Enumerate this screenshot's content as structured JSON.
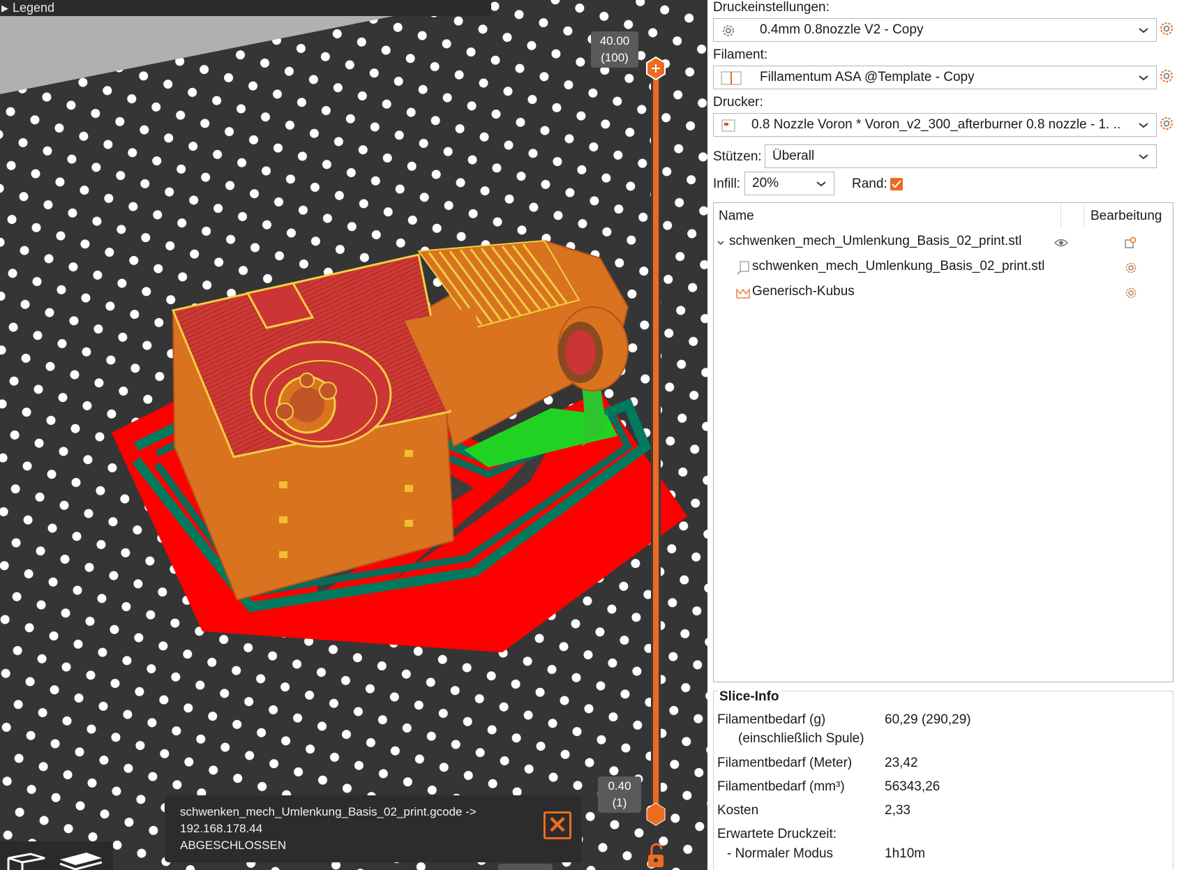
{
  "viewport": {
    "legend_label": "Legend",
    "layer_top": {
      "height": "40.00",
      "index": "(100)"
    },
    "layer_bottom": {
      "height": "0.40",
      "index": "(1)"
    },
    "notification": {
      "line1": "schwenken_mech_Umlenkung_Basis_02_print.gcode ->",
      "line2": "192.168.178.44",
      "line3": "ABGESCHLOSSEN"
    }
  },
  "panel": {
    "print_settings": {
      "label": "Druckeinstellungen:",
      "value": "0.4mm 0.8nozzle V2 - Copy"
    },
    "filament": {
      "label": "Filament:",
      "value": "Fillamentum ASA @Template - Copy"
    },
    "printer": {
      "label": "Drucker:",
      "value": "0.8 Nozzle Voron  * Voron_v2_300_afterburner 0.8 nozzle - 1. ..."
    },
    "supports": {
      "label": "Stützen:",
      "value": "Überall"
    },
    "infill": {
      "label": "Infill:",
      "value": "20%"
    },
    "brim": {
      "label": "Rand:",
      "checked": true
    },
    "object_list": {
      "col_name": "Name",
      "col_edit": "Bearbeitung",
      "rows": [
        {
          "label": "schwenken_mech_Umlenkung_Basis_02_print.stl",
          "icon": "chevron-down-icon"
        },
        {
          "label": "schwenken_mech_Umlenkung_Basis_02_print.stl",
          "icon": "part-icon"
        },
        {
          "label": "Generisch-Kubus",
          "icon": "support-blocker-icon"
        }
      ]
    },
    "slice_info": {
      "title": "Slice-Info",
      "rows": [
        {
          "label": "Filamentbedarf (g)",
          "value": "60,29 (290,29)"
        },
        {
          "label": "(einschließlich Spule)",
          "value": ""
        },
        {
          "label": "Filamentbedarf (Meter)",
          "value": "23,42"
        },
        {
          "label": "Filamentbedarf (mm³)",
          "value": "56343,26"
        },
        {
          "label": "Kosten",
          "value": "2,33"
        },
        {
          "label": "Erwartete Druckzeit:",
          "value": ""
        },
        {
          "label": "- Normaler Modus",
          "value": "1h10m"
        }
      ]
    }
  },
  "colors": {
    "accent": "#ed6b21",
    "perimeter": "#d9731f",
    "top_solid": "#cc3535",
    "skirt": "#007a5e",
    "brim_red": "#ff0000",
    "support": "#1ed21e"
  }
}
